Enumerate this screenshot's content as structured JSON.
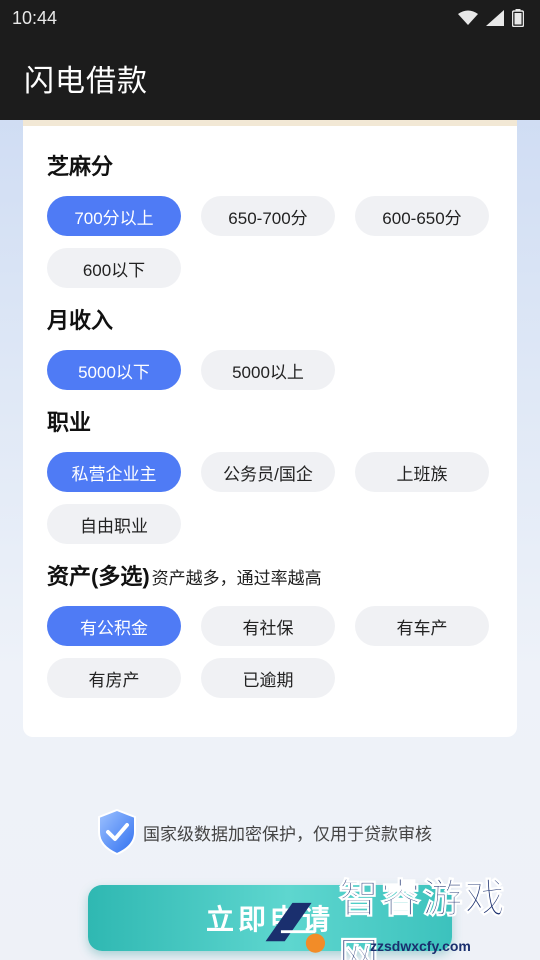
{
  "status_bar": {
    "time": "10:44"
  },
  "app_bar": {
    "title": "闪电借款"
  },
  "sections": [
    {
      "title": "芝麻分",
      "subtitle": "",
      "options": [
        {
          "label": "700分以上",
          "selected": true
        },
        {
          "label": "650-700分",
          "selected": false
        },
        {
          "label": "600-650分",
          "selected": false
        },
        {
          "label": "600以下",
          "selected": false
        }
      ]
    },
    {
      "title": "月收入",
      "subtitle": "",
      "options": [
        {
          "label": "5000以下",
          "selected": true
        },
        {
          "label": "5000以上",
          "selected": false
        }
      ]
    },
    {
      "title": "职业",
      "subtitle": "",
      "options": [
        {
          "label": "私营企业主",
          "selected": true
        },
        {
          "label": "公务员/国企",
          "selected": false
        },
        {
          "label": "上班族",
          "selected": false
        },
        {
          "label": "自由职业",
          "selected": false
        }
      ]
    },
    {
      "title": "资产(多选)",
      "subtitle": "资产越多，通过率越高",
      "options": [
        {
          "label": "有公积金",
          "selected": true
        },
        {
          "label": "有社保",
          "selected": false
        },
        {
          "label": "有车产",
          "selected": false
        },
        {
          "label": "有房产",
          "selected": false
        },
        {
          "label": "已逾期",
          "selected": false
        }
      ]
    }
  ],
  "security_note": "国家级数据加密保护，仅用于贷款审核",
  "apply_button": "立即申请",
  "watermark": {
    "text": "智睿游戏网",
    "url": "zzsdwxcfy.com"
  },
  "colors": {
    "accent": "#4f7bf5",
    "button": "#3cc2bd",
    "chip_bg": "#f0f1f4"
  }
}
